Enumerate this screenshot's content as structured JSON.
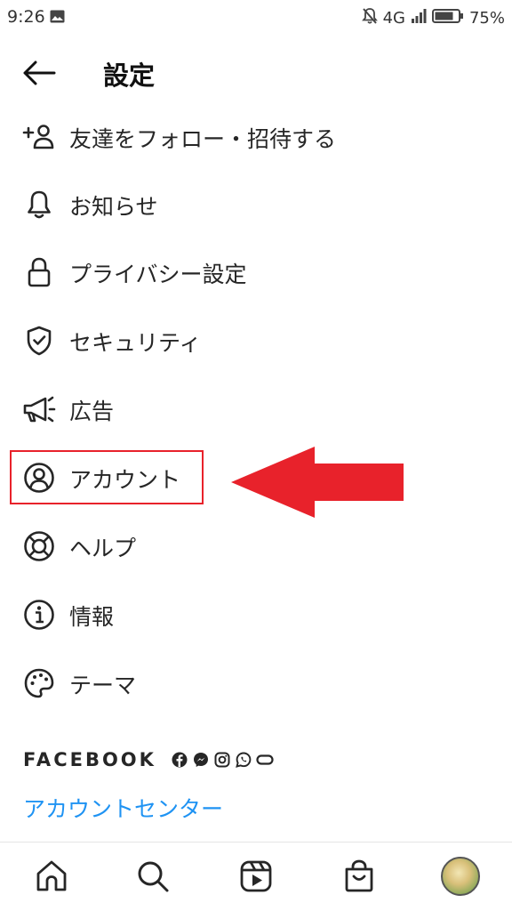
{
  "status_bar": {
    "time": "9:26",
    "network": "4G",
    "battery": "75%"
  },
  "header": {
    "title": "設定",
    "back_icon": "arrow-left-icon"
  },
  "menu": [
    {
      "key": "follow",
      "label": "友達をフォロー・招待する",
      "icon": "add-person-icon"
    },
    {
      "key": "notifications",
      "label": "お知らせ",
      "icon": "bell-icon"
    },
    {
      "key": "privacy",
      "label": "プライバシー設定",
      "icon": "lock-icon"
    },
    {
      "key": "security",
      "label": "セキュリティ",
      "icon": "shield-check-icon"
    },
    {
      "key": "ads",
      "label": "広告",
      "icon": "megaphone-icon"
    },
    {
      "key": "account",
      "label": "アカウント",
      "icon": "user-circle-icon",
      "highlighted": true
    },
    {
      "key": "help",
      "label": "ヘルプ",
      "icon": "lifebuoy-icon"
    },
    {
      "key": "about",
      "label": "情報",
      "icon": "info-icon"
    },
    {
      "key": "theme",
      "label": "テーマ",
      "icon": "palette-icon"
    }
  ],
  "facebook": {
    "label": "FACEBOOK",
    "icons": [
      "facebook-icon",
      "messenger-icon",
      "instagram-icon",
      "whatsapp-icon",
      "portal-icon"
    ],
    "account_center": "アカウントセンター"
  },
  "bottom_nav": [
    "home-icon",
    "search-icon",
    "reels-icon",
    "shop-icon",
    "profile-avatar"
  ],
  "colors": {
    "link": "#1f93f3",
    "annotation_red": "#e8222b",
    "text": "#262626"
  }
}
